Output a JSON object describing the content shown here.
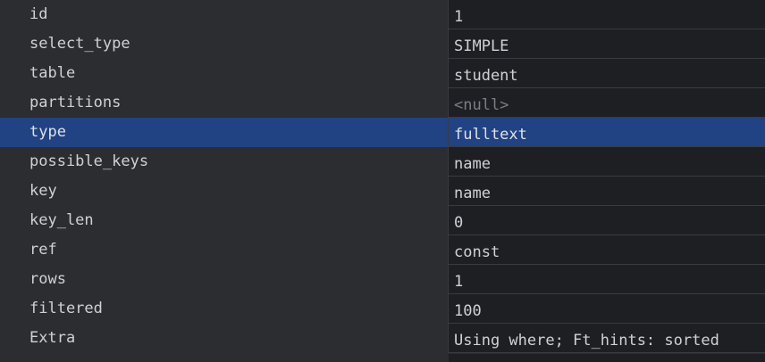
{
  "colors": {
    "background": "#2b2d30",
    "value_background": "#1e1f22",
    "selection": "#214283",
    "text": "#cfd1d6",
    "null_text": "#7a7e85"
  },
  "rows": [
    {
      "label": "id",
      "value": "1"
    },
    {
      "label": "select_type",
      "value": "SIMPLE"
    },
    {
      "label": "table",
      "value": "student"
    },
    {
      "label": "partitions",
      "value": "<null>",
      "is_null": true
    },
    {
      "label": "type",
      "value": "fulltext",
      "selected": true
    },
    {
      "label": "possible_keys",
      "value": "name"
    },
    {
      "label": "key",
      "value": "name"
    },
    {
      "label": "key_len",
      "value": "0"
    },
    {
      "label": "ref",
      "value": "const"
    },
    {
      "label": "rows",
      "value": "1"
    },
    {
      "label": "filtered",
      "value": "100"
    },
    {
      "label": "Extra",
      "value": "Using where; Ft_hints: sorted"
    }
  ]
}
